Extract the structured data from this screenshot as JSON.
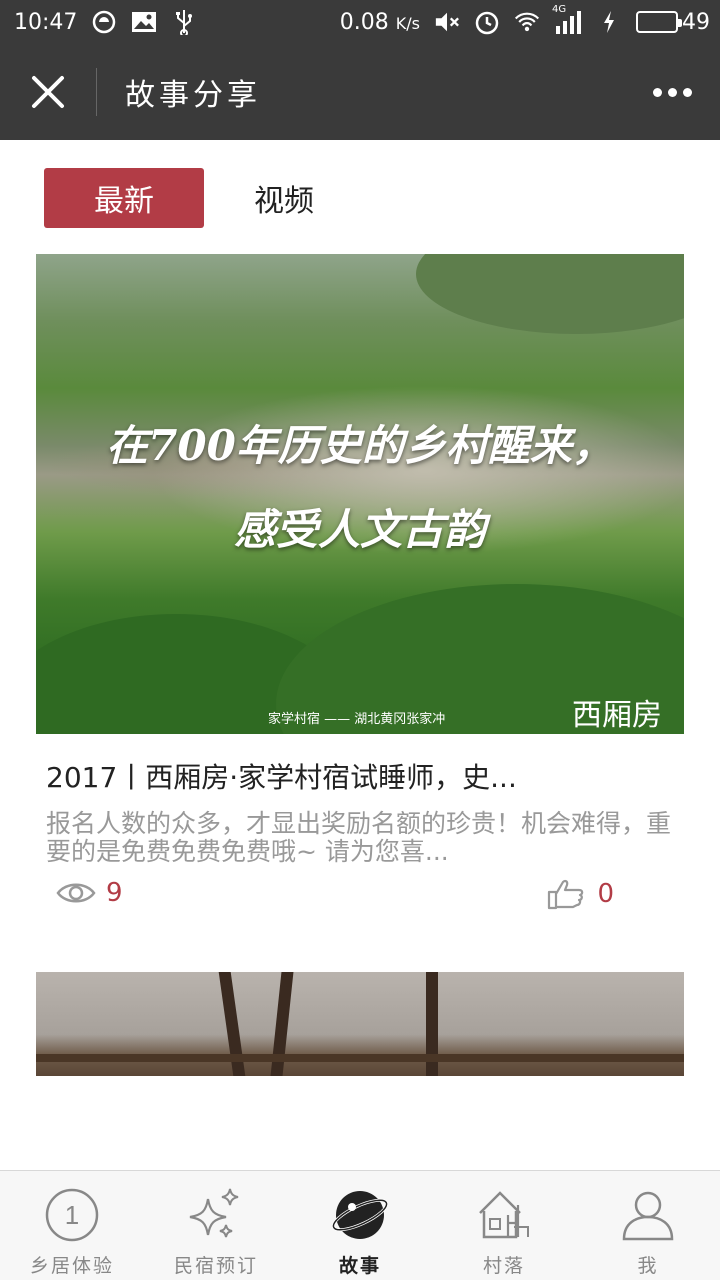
{
  "status_bar": {
    "time": "10:47",
    "net_speed": "0.08",
    "net_unit": "K/s",
    "net_type": "4G",
    "battery_level": "49",
    "battery_fraction": 0.49,
    "battery_color": "#3fd13f",
    "icons": [
      "wechat-icon",
      "image-icon",
      "usb-icon",
      "mute-icon",
      "alarm-icon",
      "wifi-icon",
      "signal-icon",
      "charging-icon"
    ]
  },
  "title_bar": {
    "title": "故事分享",
    "background": "#3a3a3a"
  },
  "tabs": [
    {
      "label": "最新",
      "active": true
    },
    {
      "label": "视频",
      "active": false
    }
  ],
  "accent_color": "#b23c46",
  "card": {
    "image_text_line1": "在700年历史的乡村醒来，",
    "image_text_line2": "感受人文古韵",
    "image_caption": "家学村宿  ——  湖北黄冈张家冲",
    "image_brand": "西厢房",
    "title": "2017丨西厢房·家学村宿试睡师，史...",
    "description": "报名人数的众多，才显出奖励名额的珍贵！机会难得，重要的是免费免费免费哦~ 请为您喜...",
    "views": "9",
    "likes": "0"
  },
  "bottom_nav": [
    {
      "label": "乡居体验",
      "icon": "number-one-circle-icon",
      "active": false
    },
    {
      "label": "民宿预订",
      "icon": "sparkle-icon",
      "active": false
    },
    {
      "label": "故事",
      "icon": "planet-icon",
      "active": true
    },
    {
      "label": "村落",
      "icon": "village-house-icon",
      "active": false
    },
    {
      "label": "我",
      "icon": "user-icon",
      "active": false
    }
  ]
}
